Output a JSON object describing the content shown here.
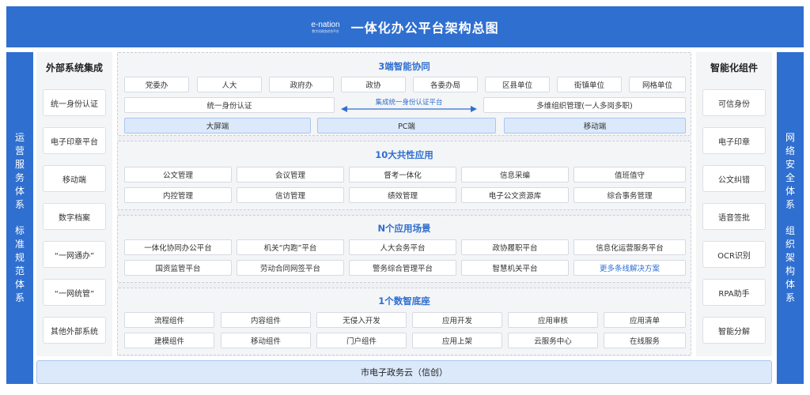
{
  "header": {
    "logo_text": "e-nation",
    "logo_sub": "数字化政务综合平台",
    "title": "一体化办公平台架构总图"
  },
  "left_band": {
    "part1": "运营服务体系",
    "part2": "标准规范体系"
  },
  "right_band": {
    "part1": "网络安全体系",
    "part2": "组织架构体系"
  },
  "left_panel": {
    "title": "外部系统集成",
    "items": [
      "统一身份认证",
      "电子印章平台",
      "移动端",
      "数字档案",
      "“一网通办”",
      "“一网统管”",
      "其他外部系统"
    ]
  },
  "right_panel": {
    "title": "智能化组件",
    "items": [
      "可信身份",
      "电子印章",
      "公文纠错",
      "语音签批",
      "OCR识别",
      "RPA助手",
      "智能分解"
    ]
  },
  "sections": {
    "s1": {
      "title": "3端智能协同",
      "orgs": [
        "党委办",
        "人大",
        "政府办",
        "政协",
        "各委办局",
        "区县单位",
        "街镇单位",
        "网格单位"
      ],
      "auth_left": "统一身份认证",
      "auth_arrow": "集成统一身份认证平台",
      "auth_right": "多维组织管理(一人多岗多职)",
      "terminals": [
        "大屏端",
        "PC端",
        "移动端"
      ]
    },
    "s2": {
      "title": "10大共性应用",
      "row1": [
        "公文管理",
        "会议管理",
        "督考一体化",
        "信息采编",
        "值班值守"
      ],
      "row2": [
        "内控管理",
        "信访管理",
        "绩效管理",
        "电子公文资源库",
        "综合事务管理"
      ]
    },
    "s3": {
      "title": "N个应用场景",
      "row1": [
        "一体化协同办公平台",
        "机关“内跑”平台",
        "人大会务平台",
        "政协履职平台",
        "信息化运营服务平台"
      ],
      "row2": [
        "国资监管平台",
        "劳动合同网签平台",
        "警务综合管理平台",
        "智慧机关平台",
        "更多条线解决方案"
      ]
    },
    "s4": {
      "title": "1个数智底座",
      "row1": [
        "流程组件",
        "内容组件",
        "无侵入开发",
        "应用开发",
        "应用审核",
        "应用清单"
      ],
      "row2": [
        "建模组件",
        "移动组件",
        "门户组件",
        "应用上架",
        "云服务中心",
        "在线服务"
      ]
    }
  },
  "footer": {
    "cloud": "市电子政务云（信创）"
  },
  "colors": {
    "primary": "#2f6fd0",
    "light_blue": "#dbe9fb",
    "panel_bg": "#f4f5f7"
  }
}
